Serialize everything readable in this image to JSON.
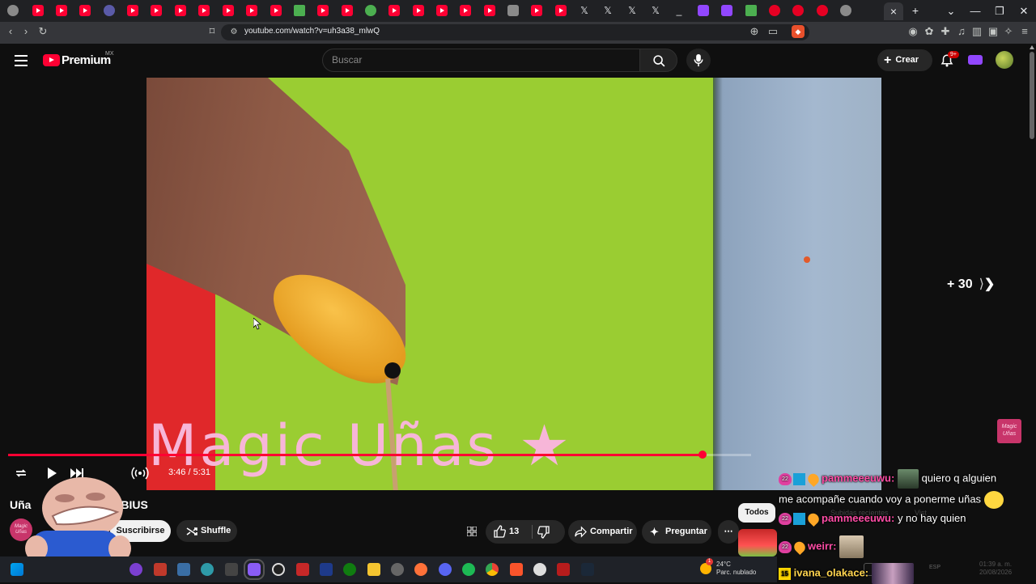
{
  "browser": {
    "url": "youtube.com/watch?v=uh3a38_mlwQ",
    "tab_close_glyph": "×",
    "new_tab_glyph": "+",
    "window_controls": [
      "⌄",
      "—",
      "❐",
      "✕"
    ]
  },
  "header": {
    "logo_text": "Premium",
    "region": "MX",
    "search_placeholder": "Buscar",
    "create_label": "Crear",
    "notifications_badge": "9+"
  },
  "player": {
    "overlay_text": "Magic Uñas ★",
    "skip_label": "+ 30",
    "time_display": "3:46 / 5:31",
    "progress_fraction": 0.935,
    "corner_logo_text": "Magic Uñas"
  },
  "video": {
    "title_start": "Uña",
    "title_end": "OBIUS",
    "channel_avatar_text": "Magic Uñas",
    "subscribe_label": "Suscribirse",
    "shuffle_label": "Shuffle",
    "likes": "13",
    "share_label": "Compartir",
    "ask_label": "Preguntar",
    "more_glyph": "⋯"
  },
  "sidebar": {
    "chip_all": "Todos",
    "faint_chip_1": "Subidas recientes",
    "faint_chip_2": "Vist"
  },
  "chat": [
    {
      "badge": "22",
      "nick": "pammeeeuwu:",
      "text": "quiero q alguien"
    },
    {
      "badge": "",
      "nick": "",
      "text": "me acompañe cuando voy a ponerme uñas"
    },
    {
      "badge": "22",
      "nick": "pammeeeuwu:",
      "text": "y no hay quien"
    },
    {
      "badge": "22",
      "nick": "weirr:",
      "text": ""
    },
    {
      "badge": "15",
      "nick": "ivana_olakace:",
      "text": ""
    }
  ],
  "taskbar": {
    "weather_temp": "24°C",
    "weather_desc": "Parc. nublado",
    "weather_badge": "1",
    "lang": "ESP",
    "clock_time": "01:39 a. m.",
    "clock_date": "20/08/2026"
  },
  "colors": {
    "accent_red": "#ff0033",
    "background": "#0f0f0f",
    "chat_nick_pink": "#ff4da6",
    "chat_nick_yellow": "#ffd54f"
  }
}
